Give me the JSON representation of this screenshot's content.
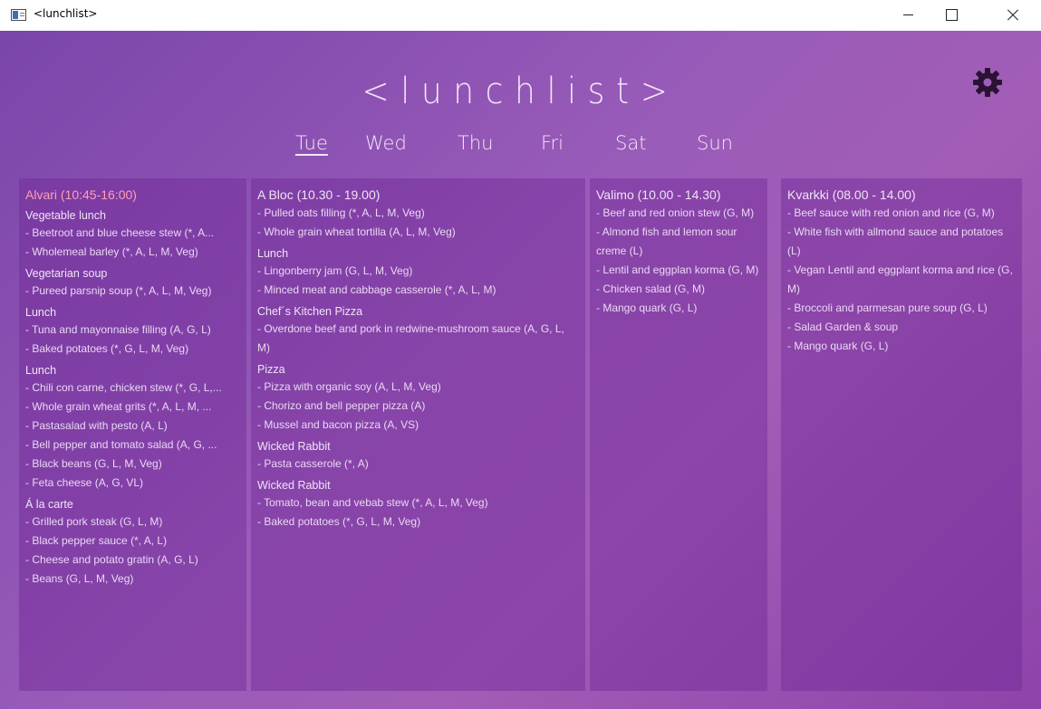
{
  "window": {
    "title": "<lunchlist>"
  },
  "app": {
    "logo": "<lunchlist>",
    "settings_icon": "gear-icon"
  },
  "days": [
    "Tue",
    "Wed",
    "Thu",
    "Fri",
    "Sat",
    "Sun"
  ],
  "active_day": "Tue",
  "colors": {
    "highlight": "#ff9fb1",
    "background": "#9a5cb9"
  },
  "restaurants": [
    {
      "name": "Alvari (10:45-16:00)",
      "sections": [
        {
          "name": "Vegetable lunch",
          "items": [
            "- Beetroot and blue cheese stew (*, A...",
            "- Wholemeal barley (*, A, L, M, Veg)"
          ]
        },
        {
          "name": "Vegetarian soup",
          "items": [
            "- Pureed parsnip soup (*, A, L, M, Veg)"
          ]
        },
        {
          "name": "Lunch",
          "items": [
            "- Tuna and mayonnaise filling (A, G, L)",
            "- Baked potatoes (*, G, L, M, Veg)"
          ]
        },
        {
          "name": "Lunch",
          "items": [
            "- Chili con carne, chicken stew (*, G, L,...",
            "- Whole grain wheat grits (*, A, L, M, ...",
            "- Pastasalad with pesto (A, L)",
            "- Bell pepper and tomato salad (A, G, ...",
            "- Black beans (G, L, M, Veg)",
            "- Feta cheese (A, G, VL)"
          ]
        },
        {
          "name": "Á la carte",
          "items": [
            "- Grilled pork steak (G, L, M)",
            "- Black pepper sauce (*, A, L)",
            "- Cheese and potato gratin (A, G, L)",
            "- Beans (G, L, M, Veg)"
          ]
        }
      ]
    },
    {
      "name": "A Bloc (10.30 - 19.00)",
      "sections": [
        {
          "name": "",
          "items": [
            "- Pulled oats filling (*, A, L, M, Veg)",
            "- Whole grain wheat tortilla (A, L, M, Veg)"
          ]
        },
        {
          "name": "Lunch",
          "items": [
            "- Lingonberry jam (G, L, M, Veg)",
            "- Minced meat and cabbage casserole (*, A, L, M)"
          ]
        },
        {
          "name": "Chef´s Kitchen Pizza",
          "items": [
            "- Overdone beef and pork in redwine-mushroom sauce (A, G, L, M)"
          ]
        },
        {
          "name": "Pizza",
          "items": [
            "- Pizza with organic soy (A, L, M, Veg)",
            "- Chorizo and bell pepper pizza (A)",
            "- Mussel and bacon pizza (A, VS)"
          ]
        },
        {
          "name": "Wicked Rabbit",
          "items": [
            "- Pasta casserole (*, A)"
          ]
        },
        {
          "name": "Wicked Rabbit",
          "items": [
            "- Tomato, bean and vebab stew (*, A, L, M, Veg)",
            "- Baked potatoes (*, G, L, M, Veg)"
          ]
        }
      ]
    },
    {
      "name": "Valimo (10.00 - 14.30)",
      "sections": [
        {
          "name": "",
          "items": [
            "- Beef and red onion stew (G, M)",
            "- Almond fish and lemon sour creme (L)",
            "- Lentil and eggplan korma (G, M)",
            "- Chicken salad (G, M)",
            "- Mango quark (G, L)"
          ]
        }
      ]
    },
    {
      "name": "Kvarkki (08.00 - 14.00)",
      "sections": [
        {
          "name": "",
          "items": [
            "- Beef sauce with red onion and rice (G, M)",
            "- White fish with allmond sauce and potatoes (L)",
            "- Vegan Lentil and eggplant korma and rice (G, M)",
            "- Broccoli and parmesan pure soup (G, L)",
            "- Salad Garden & soup",
            "- Mango quark (G, L)"
          ]
        }
      ]
    }
  ]
}
